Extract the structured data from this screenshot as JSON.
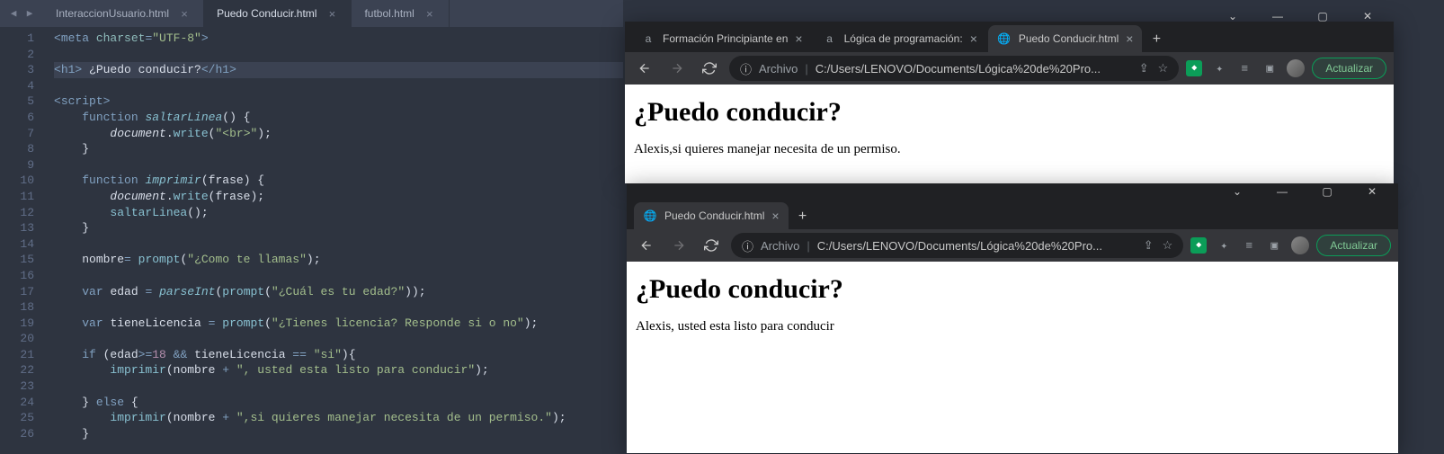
{
  "editor": {
    "tabs": [
      {
        "name": "InteraccionUsuario.html",
        "active": false
      },
      {
        "name": "Puedo Conducir.html",
        "active": true
      },
      {
        "name": "futbol.html",
        "active": false
      }
    ],
    "active_line": 3,
    "code": [
      {
        "n": 1,
        "segs": [
          {
            "t": "<",
            "c": "tag"
          },
          {
            "t": "meta ",
            "c": "tag"
          },
          {
            "t": "charset",
            "c": "attr"
          },
          {
            "t": "=",
            "c": "op"
          },
          {
            "t": "\"UTF-8\"",
            "c": "str"
          },
          {
            "t": ">",
            "c": "tag"
          }
        ],
        "i": 0
      },
      {
        "n": 2,
        "segs": [],
        "i": 0
      },
      {
        "n": 3,
        "segs": [
          {
            "t": "<",
            "c": "tag"
          },
          {
            "t": "h1",
            "c": "tag"
          },
          {
            "t": "> ",
            "c": "tag"
          },
          {
            "t": "¿Puedo conducir?",
            "c": "id"
          },
          {
            "t": "</",
            "c": "tag"
          },
          {
            "t": "h1",
            "c": "tag"
          },
          {
            "t": ">",
            "c": "tag"
          }
        ],
        "i": 0
      },
      {
        "n": 4,
        "segs": [],
        "i": 0
      },
      {
        "n": 5,
        "segs": [
          {
            "t": "<",
            "c": "tag"
          },
          {
            "t": "script",
            "c": "tag"
          },
          {
            "t": ">",
            "c": "tag"
          }
        ],
        "i": 0
      },
      {
        "n": 6,
        "segs": [
          {
            "t": "function ",
            "c": "kw"
          },
          {
            "t": "saltarLinea",
            "c": "fn"
          },
          {
            "t": "() {",
            "c": "punc"
          }
        ],
        "i": 1
      },
      {
        "n": 7,
        "segs": [
          {
            "t": "document",
            "c": "idit"
          },
          {
            "t": ".",
            "c": "punc"
          },
          {
            "t": "write",
            "c": "fnc"
          },
          {
            "t": "(",
            "c": "punc"
          },
          {
            "t": "\"<br>\"",
            "c": "str"
          },
          {
            "t": ");",
            "c": "punc"
          }
        ],
        "i": 2
      },
      {
        "n": 8,
        "segs": [
          {
            "t": "}",
            "c": "punc"
          }
        ],
        "i": 1
      },
      {
        "n": 9,
        "segs": [],
        "i": 0
      },
      {
        "n": 10,
        "segs": [
          {
            "t": "function ",
            "c": "kw"
          },
          {
            "t": "imprimir",
            "c": "fn"
          },
          {
            "t": "(",
            "c": "punc"
          },
          {
            "t": "frase",
            "c": "id"
          },
          {
            "t": ") {",
            "c": "punc"
          }
        ],
        "i": 1
      },
      {
        "n": 11,
        "segs": [
          {
            "t": "document",
            "c": "idit"
          },
          {
            "t": ".",
            "c": "punc"
          },
          {
            "t": "write",
            "c": "fnc"
          },
          {
            "t": "(frase);",
            "c": "punc"
          }
        ],
        "i": 2
      },
      {
        "n": 12,
        "segs": [
          {
            "t": "saltarLinea",
            "c": "fnc"
          },
          {
            "t": "();",
            "c": "punc"
          }
        ],
        "i": 2
      },
      {
        "n": 13,
        "segs": [
          {
            "t": "}",
            "c": "punc"
          }
        ],
        "i": 1
      },
      {
        "n": 14,
        "segs": [],
        "i": 0
      },
      {
        "n": 15,
        "segs": [
          {
            "t": "nombre",
            "c": "id"
          },
          {
            "t": "= ",
            "c": "op"
          },
          {
            "t": "prompt",
            "c": "fnc"
          },
          {
            "t": "(",
            "c": "punc"
          },
          {
            "t": "\"¿Como te llamas\"",
            "c": "str"
          },
          {
            "t": ");",
            "c": "punc"
          }
        ],
        "i": 1
      },
      {
        "n": 16,
        "segs": [],
        "i": 0
      },
      {
        "n": 17,
        "segs": [
          {
            "t": "var ",
            "c": "kw"
          },
          {
            "t": "edad ",
            "c": "id"
          },
          {
            "t": "= ",
            "c": "op"
          },
          {
            "t": "parseInt",
            "c": "fn"
          },
          {
            "t": "(",
            "c": "punc"
          },
          {
            "t": "prompt",
            "c": "fnc"
          },
          {
            "t": "(",
            "c": "punc"
          },
          {
            "t": "\"¿Cuál es tu edad?\"",
            "c": "str"
          },
          {
            "t": "));",
            "c": "punc"
          }
        ],
        "i": 1
      },
      {
        "n": 18,
        "segs": [],
        "i": 0
      },
      {
        "n": 19,
        "segs": [
          {
            "t": "var ",
            "c": "kw"
          },
          {
            "t": "tieneLicencia ",
            "c": "id"
          },
          {
            "t": "= ",
            "c": "op"
          },
          {
            "t": "prompt",
            "c": "fnc"
          },
          {
            "t": "(",
            "c": "punc"
          },
          {
            "t": "\"¿Tienes licencia? Responde si o no\"",
            "c": "str"
          },
          {
            "t": ");",
            "c": "punc"
          }
        ],
        "i": 1
      },
      {
        "n": 20,
        "segs": [],
        "i": 0
      },
      {
        "n": 21,
        "segs": [
          {
            "t": "if ",
            "c": "kw"
          },
          {
            "t": "(edad",
            "c": "punc"
          },
          {
            "t": ">=",
            "c": "op"
          },
          {
            "t": "18",
            "c": "num"
          },
          {
            "t": " && ",
            "c": "op"
          },
          {
            "t": "tieneLicencia ",
            "c": "id"
          },
          {
            "t": "== ",
            "c": "op"
          },
          {
            "t": "\"si\"",
            "c": "str"
          },
          {
            "t": "){",
            "c": "punc"
          }
        ],
        "i": 1
      },
      {
        "n": 22,
        "segs": [
          {
            "t": "imprimir",
            "c": "fnc"
          },
          {
            "t": "(nombre ",
            "c": "punc"
          },
          {
            "t": "+ ",
            "c": "op"
          },
          {
            "t": "\", usted esta listo para conducir\"",
            "c": "str"
          },
          {
            "t": ");",
            "c": "punc"
          }
        ],
        "i": 2
      },
      {
        "n": 23,
        "segs": [],
        "i": 0
      },
      {
        "n": 24,
        "segs": [
          {
            "t": "} ",
            "c": "punc"
          },
          {
            "t": "else ",
            "c": "kw"
          },
          {
            "t": "{",
            "c": "punc"
          }
        ],
        "i": 1
      },
      {
        "n": 25,
        "segs": [
          {
            "t": "imprimir",
            "c": "fnc"
          },
          {
            "t": "(nombre ",
            "c": "punc"
          },
          {
            "t": "+ ",
            "c": "op"
          },
          {
            "t": "\",si quieres manejar necesita de un permiso.\"",
            "c": "str"
          },
          {
            "t": ");",
            "c": "punc"
          }
        ],
        "i": 2
      },
      {
        "n": 26,
        "segs": [
          {
            "t": "}",
            "c": "punc"
          }
        ],
        "i": 1
      }
    ]
  },
  "browser1": {
    "tabs": [
      {
        "favicon": "a",
        "title": "Formación Principiante en",
        "active": false
      },
      {
        "favicon": "a",
        "title": "Lógica de programación:",
        "active": false
      },
      {
        "favicon": "🌐",
        "title": "Puedo Conducir.html",
        "active": true
      }
    ],
    "addr_prefix": "Archivo",
    "addr_url": "C:/Users/LENOVO/Documents/Lógica%20de%20Pro...",
    "update_label": "Actualizar",
    "page_h1": "¿Puedo conducir?",
    "page_text": "Alexis,si quieres manejar necesita de un permiso."
  },
  "browser2": {
    "tabs": [
      {
        "favicon": "🌐",
        "title": "Puedo Conducir.html",
        "active": true
      }
    ],
    "addr_prefix": "Archivo",
    "addr_url": "C:/Users/LENOVO/Documents/Lógica%20de%20Pro...",
    "update_label": "Actualizar",
    "page_h1": "¿Puedo conducir?",
    "page_text": "Alexis, usted esta listo para conducir"
  },
  "win_controls": {
    "caret": "⌄",
    "min": "—",
    "max": "▢",
    "close": "✕"
  }
}
